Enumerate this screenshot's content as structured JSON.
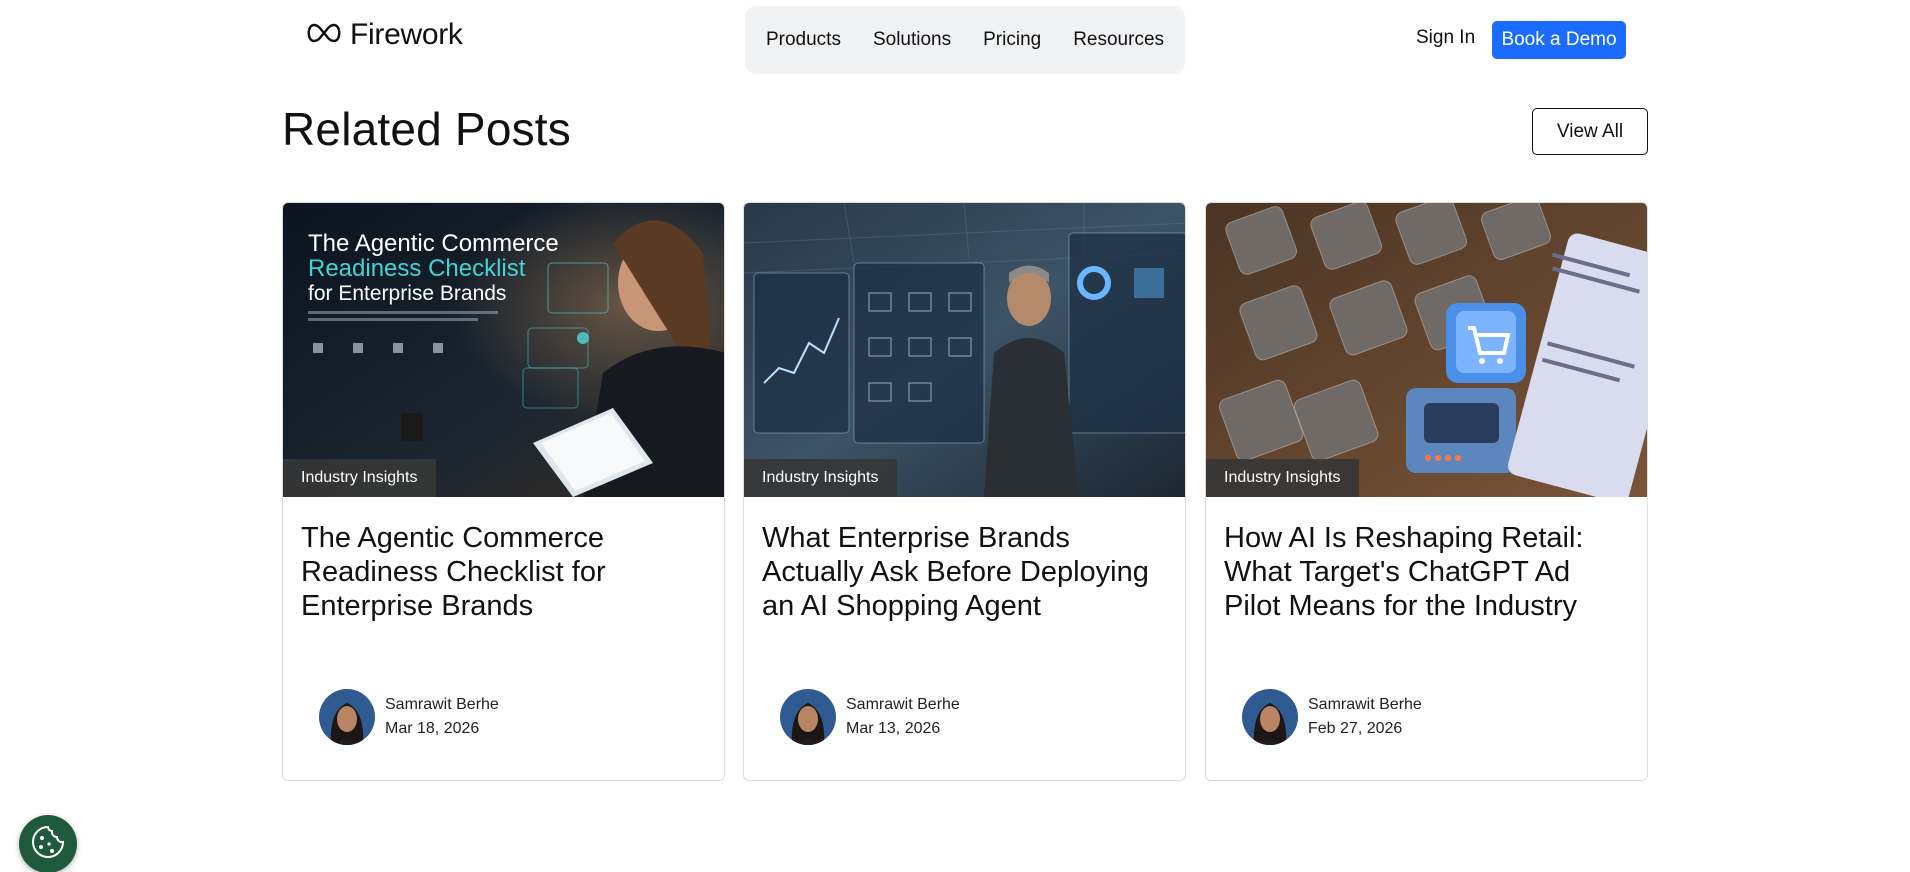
{
  "brand": {
    "name": "Firework"
  },
  "nav": {
    "links": [
      "Products",
      "Solutions",
      "Pricing",
      "Resources"
    ],
    "sign_in": "Sign In",
    "cta": "Book a Demo"
  },
  "section": {
    "title": "Related Posts",
    "view_all": "View All"
  },
  "posts": [
    {
      "tag": "Industry Insights",
      "title": "The Agentic Commerce Readiness Checklist for Enterprise Brands",
      "author": "Samrawit Berhe",
      "date": "Mar 18, 2026",
      "image_text": {
        "line1": "The Agentic Commerce",
        "line2": "Readiness Checklist",
        "line3": "for Enterprise Brands"
      }
    },
    {
      "tag": "Industry Insights",
      "title": "What Enterprise Brands Actually Ask Before Deploying an AI Shopping Agent",
      "author": "Samrawit Berhe",
      "date": "Mar 13, 2026"
    },
    {
      "tag": "Industry Insights",
      "title": "How AI Is Reshaping Retail: What Target's ChatGPT Ad Pilot Means for the Industry",
      "author": "Samrawit Berhe",
      "date": "Feb 27, 2026"
    }
  ],
  "colors": {
    "accent": "#1a6cff",
    "tag_bg": "#363636",
    "cookie_bg": "#1f5a3c",
    "nav_pill": "#f1f2f4"
  }
}
